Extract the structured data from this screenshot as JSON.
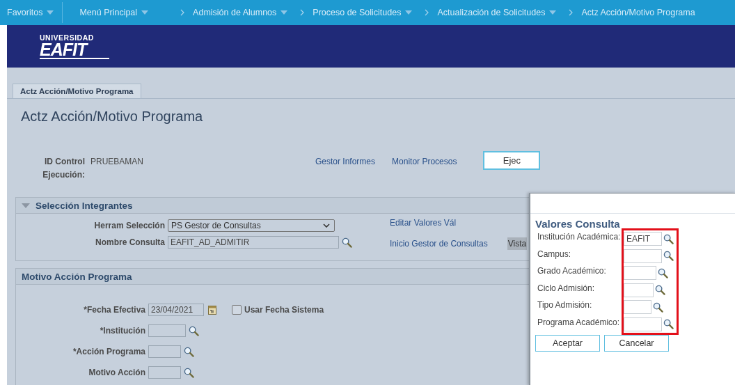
{
  "nav_bar": {
    "items": [
      {
        "label": "Favoritos",
        "has_menu": true,
        "breadcrumb": false
      },
      {
        "label": "Menú Principal",
        "has_menu": true,
        "breadcrumb": false
      },
      {
        "label": "Admisión de Alumnos",
        "has_menu": true,
        "breadcrumb": true
      },
      {
        "label": "Proceso de Solicitudes",
        "has_menu": true,
        "breadcrumb": true
      },
      {
        "label": "Actualización de Solicitudes",
        "has_menu": true,
        "breadcrumb": true
      },
      {
        "label": "Actz Acción/Motivo Programa",
        "has_menu": false,
        "breadcrumb": true
      }
    ]
  },
  "header": {
    "logo_top": "UNIVERSIDAD",
    "logo_main": "EAFIT"
  },
  "tabs": [
    {
      "label": "Actz Acción/Motivo Programa",
      "selected": true
    }
  ],
  "page_title": "Actz Acción/Motivo Programa",
  "run_control": {
    "label": "ID Control Ejecución:",
    "value": "PRUEBAMAN",
    "links": [
      "Gestor Informes",
      "Monitor Procesos"
    ],
    "button": "Ejec"
  },
  "selection_section": {
    "title": "Selección Integrantes",
    "expanded": true,
    "fields": [
      {
        "label": "Herram Selección",
        "kind": "select",
        "value": "PS Gestor de Consultas"
      },
      {
        "label": "Nombre Consulta",
        "kind": "lookup",
        "value": "EAFIT_AD_ADMITIR"
      }
    ],
    "links": [
      "Editar Valores Vál",
      "Inicio Gestor de Consultas"
    ],
    "partial_button": "Vista"
  },
  "motivo_section": {
    "title": "Motivo Acción Programa",
    "fields": [
      {
        "label": "*Fecha Efectiva",
        "kind": "date",
        "value": "23/04/2021",
        "checkbox": {
          "label": "Usar Fecha Sistema",
          "checked": false
        }
      },
      {
        "label": "*Institución",
        "kind": "lookup"
      },
      {
        "label": "*Acción Programa",
        "kind": "lookup"
      },
      {
        "label": "Motivo Acción",
        "kind": "lookup"
      }
    ]
  },
  "dialog": {
    "title": "Valores Consulta",
    "fields": [
      {
        "label": "Institución Académica:",
        "value": "EAFIT"
      },
      {
        "label": "Campus:"
      },
      {
        "label": "Grado Académico:"
      },
      {
        "label": "Ciclo Admisión:"
      },
      {
        "label": "Tipo Admisión:"
      },
      {
        "label": "Programa Académico:"
      }
    ],
    "buttons": [
      "Aceptar",
      "Cancelar"
    ]
  }
}
